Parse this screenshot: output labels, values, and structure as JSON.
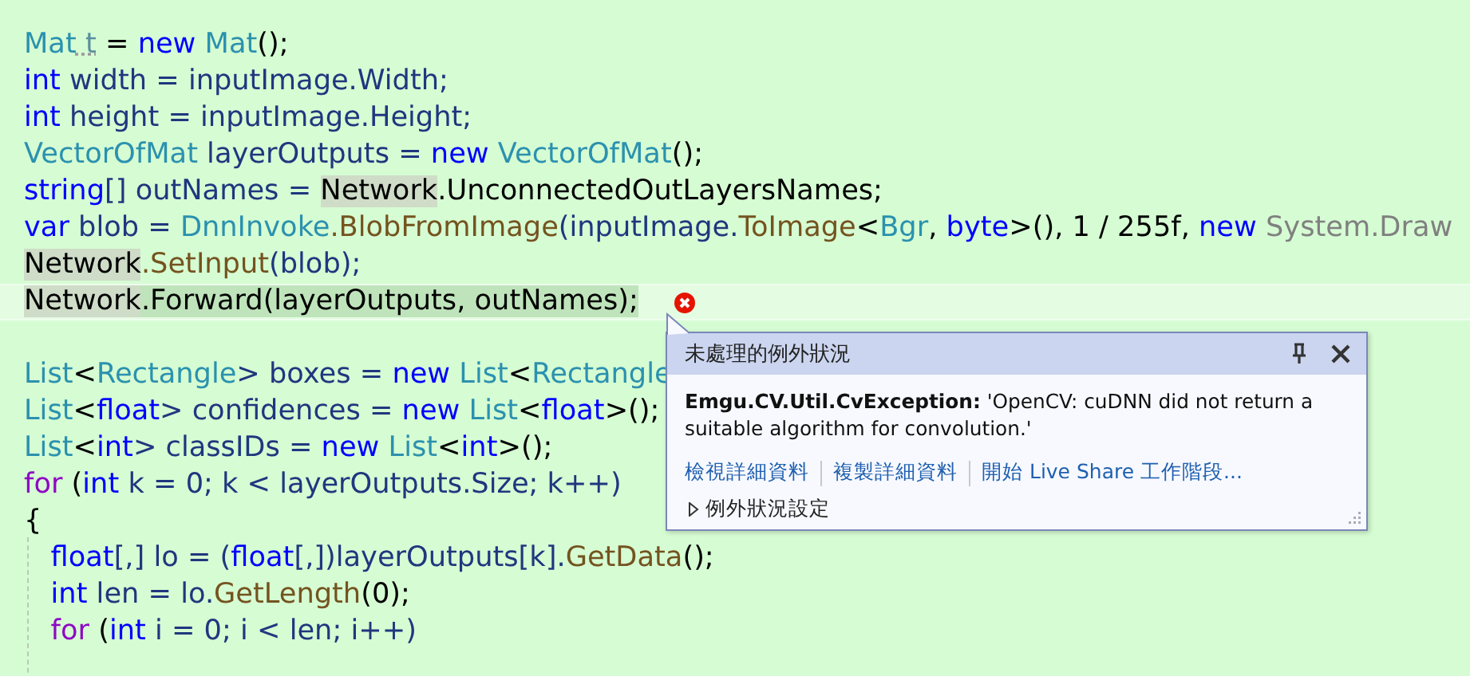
{
  "editor": {
    "lines": [
      {
        "kind": "code",
        "current": false,
        "error": false,
        "tokens": [
          {
            "text": "Mat",
            "kind": "type"
          },
          {
            "text": " t",
            "kind": "unused"
          },
          {
            "text": " = ",
            "kind": "plain"
          },
          {
            "text": "new",
            "kind": "keyword"
          },
          {
            "text": " Mat",
            "kind": "type"
          },
          {
            "text": "();",
            "kind": "plain"
          }
        ]
      },
      {
        "kind": "code",
        "current": false,
        "error": false,
        "tokens": [
          {
            "text": "int",
            "kind": "keyword"
          },
          {
            "text": " width = inputImage.Width;",
            "kind": "local"
          }
        ]
      },
      {
        "kind": "code",
        "current": false,
        "error": false,
        "tokens": [
          {
            "text": "int",
            "kind": "keyword"
          },
          {
            "text": " height = inputImage.Height;",
            "kind": "local"
          }
        ]
      },
      {
        "kind": "code",
        "current": false,
        "error": false,
        "tokens": [
          {
            "text": "VectorOfMat",
            "kind": "type"
          },
          {
            "text": " layerOutputs = ",
            "kind": "local"
          },
          {
            "text": "new",
            "kind": "keyword"
          },
          {
            "text": " VectorOfMat",
            "kind": "type"
          },
          {
            "text": "();",
            "kind": "plain"
          }
        ]
      },
      {
        "kind": "code",
        "current": false,
        "error": false,
        "tokens": [
          {
            "text": "string",
            "kind": "keyword"
          },
          {
            "text": "[] outNames = ",
            "kind": "local"
          },
          {
            "text": "Network",
            "kind": "reference"
          },
          {
            "text": ".UnconnectedOutLayersNames;",
            "kind": "plain"
          }
        ]
      },
      {
        "kind": "code",
        "current": false,
        "error": false,
        "tokens": [
          {
            "text": "var",
            "kind": "keyword"
          },
          {
            "text": " blob = ",
            "kind": "local"
          },
          {
            "text": "DnnInvoke",
            "kind": "type"
          },
          {
            "text": ".BlobFromImage",
            "kind": "method"
          },
          {
            "text": "(inputImage.",
            "kind": "local"
          },
          {
            "text": "ToImage",
            "kind": "method"
          },
          {
            "text": "<",
            "kind": "plain"
          },
          {
            "text": "Bgr",
            "kind": "type"
          },
          {
            "text": ", ",
            "kind": "plain"
          },
          {
            "text": "byte",
            "kind": "keyword"
          },
          {
            "text": ">(), 1 / 255f, ",
            "kind": "plain"
          },
          {
            "text": "new",
            "kind": "keyword"
          },
          {
            "text": " System.Draw",
            "kind": "gray"
          }
        ]
      },
      {
        "kind": "code",
        "current": false,
        "error": false,
        "tokens": [
          {
            "text": "Network",
            "kind": "reference"
          },
          {
            "text": ".SetInput",
            "kind": "method"
          },
          {
            "text": "(blob);",
            "kind": "local"
          }
        ]
      },
      {
        "kind": "code",
        "current": true,
        "error": true,
        "tokens": [
          {
            "text": "Network",
            "kind": "reference"
          },
          {
            "text": ".Forward(layerOutputs, outNames);",
            "kind": "statement"
          }
        ]
      },
      {
        "kind": "blank"
      },
      {
        "kind": "code",
        "current": false,
        "error": false,
        "tokens": [
          {
            "text": "List",
            "kind": "type"
          },
          {
            "text": "<",
            "kind": "plain"
          },
          {
            "text": "Rectangle",
            "kind": "type"
          },
          {
            "text": "> boxes = ",
            "kind": "local"
          },
          {
            "text": "new",
            "kind": "keyword"
          },
          {
            "text": " List",
            "kind": "type"
          },
          {
            "text": "<",
            "kind": "plain"
          },
          {
            "text": "Rectangle",
            "kind": "type"
          }
        ]
      },
      {
        "kind": "code",
        "current": false,
        "error": false,
        "tokens": [
          {
            "text": "List",
            "kind": "type"
          },
          {
            "text": "<",
            "kind": "plain"
          },
          {
            "text": "float",
            "kind": "keyword"
          },
          {
            "text": "> confidences = ",
            "kind": "local"
          },
          {
            "text": "new",
            "kind": "keyword"
          },
          {
            "text": " List",
            "kind": "type"
          },
          {
            "text": "<",
            "kind": "plain"
          },
          {
            "text": "float",
            "kind": "keyword"
          },
          {
            "text": ">();",
            "kind": "plain"
          }
        ]
      },
      {
        "kind": "code",
        "current": false,
        "error": false,
        "tokens": [
          {
            "text": "List",
            "kind": "type"
          },
          {
            "text": "<",
            "kind": "plain"
          },
          {
            "text": "int",
            "kind": "keyword"
          },
          {
            "text": "> classIDs = ",
            "kind": "local"
          },
          {
            "text": "new",
            "kind": "keyword"
          },
          {
            "text": " List",
            "kind": "type"
          },
          {
            "text": "<",
            "kind": "plain"
          },
          {
            "text": "int",
            "kind": "keyword"
          },
          {
            "text": ">();",
            "kind": "plain"
          }
        ]
      },
      {
        "kind": "code",
        "current": false,
        "error": false,
        "tokens": [
          {
            "text": "for",
            "kind": "control"
          },
          {
            "text": " (",
            "kind": "plain"
          },
          {
            "text": "int",
            "kind": "keyword"
          },
          {
            "text": " k = 0; k < layerOutputs.Size; k++)",
            "kind": "local"
          }
        ]
      },
      {
        "kind": "code",
        "current": false,
        "error": false,
        "tokens": [
          {
            "text": "{",
            "kind": "plain"
          }
        ]
      },
      {
        "kind": "code",
        "current": false,
        "error": false,
        "tokens": [
          {
            "text": "   float",
            "kind": "keyword"
          },
          {
            "text": "[,] lo = (",
            "kind": "local"
          },
          {
            "text": "float",
            "kind": "keyword"
          },
          {
            "text": "[,])layerOutputs[k].",
            "kind": "local"
          },
          {
            "text": "GetData",
            "kind": "method"
          },
          {
            "text": "();",
            "kind": "plain"
          }
        ]
      },
      {
        "kind": "code",
        "current": false,
        "error": false,
        "tokens": [
          {
            "text": "   int",
            "kind": "keyword"
          },
          {
            "text": " len = lo.",
            "kind": "local"
          },
          {
            "text": "GetLength",
            "kind": "method"
          },
          {
            "text": "(0);",
            "kind": "plain"
          }
        ]
      },
      {
        "kind": "code",
        "current": false,
        "error": false,
        "tokens": [
          {
            "text": "   for",
            "kind": "control"
          },
          {
            "text": " (",
            "kind": "plain"
          },
          {
            "text": "int",
            "kind": "keyword"
          },
          {
            "text": " i = 0; i < len; i++)",
            "kind": "local"
          }
        ]
      }
    ]
  },
  "exception_popup": {
    "title": "未處理的例外狀況",
    "message": "**Emgu.CV.Util.CvException:** 'OpenCV: cuDNN did not return a suitable algorithm for convolution.'",
    "links": [
      "檢視詳細資料",
      "複製詳細資料",
      "開始 Live Share 工作階段..."
    ],
    "settings": {
      "label": "例外狀況設定",
      "expanded": false
    }
  }
}
